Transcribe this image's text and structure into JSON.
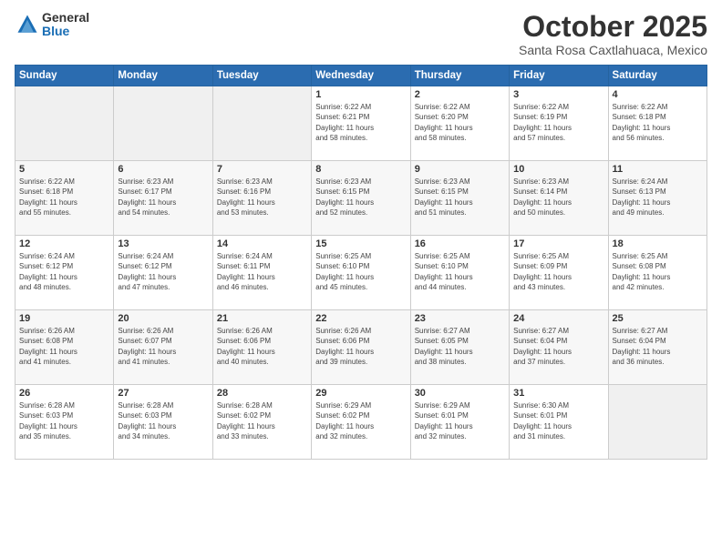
{
  "header": {
    "logo_general": "General",
    "logo_blue": "Blue",
    "month": "October 2025",
    "location": "Santa Rosa Caxtlahuaca, Mexico"
  },
  "days_of_week": [
    "Sunday",
    "Monday",
    "Tuesday",
    "Wednesday",
    "Thursday",
    "Friday",
    "Saturday"
  ],
  "weeks": [
    [
      {
        "day": "",
        "info": ""
      },
      {
        "day": "",
        "info": ""
      },
      {
        "day": "",
        "info": ""
      },
      {
        "day": "1",
        "info": "Sunrise: 6:22 AM\nSunset: 6:21 PM\nDaylight: 11 hours\nand 58 minutes."
      },
      {
        "day": "2",
        "info": "Sunrise: 6:22 AM\nSunset: 6:20 PM\nDaylight: 11 hours\nand 58 minutes."
      },
      {
        "day": "3",
        "info": "Sunrise: 6:22 AM\nSunset: 6:19 PM\nDaylight: 11 hours\nand 57 minutes."
      },
      {
        "day": "4",
        "info": "Sunrise: 6:22 AM\nSunset: 6:18 PM\nDaylight: 11 hours\nand 56 minutes."
      }
    ],
    [
      {
        "day": "5",
        "info": "Sunrise: 6:22 AM\nSunset: 6:18 PM\nDaylight: 11 hours\nand 55 minutes."
      },
      {
        "day": "6",
        "info": "Sunrise: 6:23 AM\nSunset: 6:17 PM\nDaylight: 11 hours\nand 54 minutes."
      },
      {
        "day": "7",
        "info": "Sunrise: 6:23 AM\nSunset: 6:16 PM\nDaylight: 11 hours\nand 53 minutes."
      },
      {
        "day": "8",
        "info": "Sunrise: 6:23 AM\nSunset: 6:15 PM\nDaylight: 11 hours\nand 52 minutes."
      },
      {
        "day": "9",
        "info": "Sunrise: 6:23 AM\nSunset: 6:15 PM\nDaylight: 11 hours\nand 51 minutes."
      },
      {
        "day": "10",
        "info": "Sunrise: 6:23 AM\nSunset: 6:14 PM\nDaylight: 11 hours\nand 50 minutes."
      },
      {
        "day": "11",
        "info": "Sunrise: 6:24 AM\nSunset: 6:13 PM\nDaylight: 11 hours\nand 49 minutes."
      }
    ],
    [
      {
        "day": "12",
        "info": "Sunrise: 6:24 AM\nSunset: 6:12 PM\nDaylight: 11 hours\nand 48 minutes."
      },
      {
        "day": "13",
        "info": "Sunrise: 6:24 AM\nSunset: 6:12 PM\nDaylight: 11 hours\nand 47 minutes."
      },
      {
        "day": "14",
        "info": "Sunrise: 6:24 AM\nSunset: 6:11 PM\nDaylight: 11 hours\nand 46 minutes."
      },
      {
        "day": "15",
        "info": "Sunrise: 6:25 AM\nSunset: 6:10 PM\nDaylight: 11 hours\nand 45 minutes."
      },
      {
        "day": "16",
        "info": "Sunrise: 6:25 AM\nSunset: 6:10 PM\nDaylight: 11 hours\nand 44 minutes."
      },
      {
        "day": "17",
        "info": "Sunrise: 6:25 AM\nSunset: 6:09 PM\nDaylight: 11 hours\nand 43 minutes."
      },
      {
        "day": "18",
        "info": "Sunrise: 6:25 AM\nSunset: 6:08 PM\nDaylight: 11 hours\nand 42 minutes."
      }
    ],
    [
      {
        "day": "19",
        "info": "Sunrise: 6:26 AM\nSunset: 6:08 PM\nDaylight: 11 hours\nand 41 minutes."
      },
      {
        "day": "20",
        "info": "Sunrise: 6:26 AM\nSunset: 6:07 PM\nDaylight: 11 hours\nand 41 minutes."
      },
      {
        "day": "21",
        "info": "Sunrise: 6:26 AM\nSunset: 6:06 PM\nDaylight: 11 hours\nand 40 minutes."
      },
      {
        "day": "22",
        "info": "Sunrise: 6:26 AM\nSunset: 6:06 PM\nDaylight: 11 hours\nand 39 minutes."
      },
      {
        "day": "23",
        "info": "Sunrise: 6:27 AM\nSunset: 6:05 PM\nDaylight: 11 hours\nand 38 minutes."
      },
      {
        "day": "24",
        "info": "Sunrise: 6:27 AM\nSunset: 6:04 PM\nDaylight: 11 hours\nand 37 minutes."
      },
      {
        "day": "25",
        "info": "Sunrise: 6:27 AM\nSunset: 6:04 PM\nDaylight: 11 hours\nand 36 minutes."
      }
    ],
    [
      {
        "day": "26",
        "info": "Sunrise: 6:28 AM\nSunset: 6:03 PM\nDaylight: 11 hours\nand 35 minutes."
      },
      {
        "day": "27",
        "info": "Sunrise: 6:28 AM\nSunset: 6:03 PM\nDaylight: 11 hours\nand 34 minutes."
      },
      {
        "day": "28",
        "info": "Sunrise: 6:28 AM\nSunset: 6:02 PM\nDaylight: 11 hours\nand 33 minutes."
      },
      {
        "day": "29",
        "info": "Sunrise: 6:29 AM\nSunset: 6:02 PM\nDaylight: 11 hours\nand 32 minutes."
      },
      {
        "day": "30",
        "info": "Sunrise: 6:29 AM\nSunset: 6:01 PM\nDaylight: 11 hours\nand 32 minutes."
      },
      {
        "day": "31",
        "info": "Sunrise: 6:30 AM\nSunset: 6:01 PM\nDaylight: 11 hours\nand 31 minutes."
      },
      {
        "day": "",
        "info": ""
      }
    ]
  ]
}
